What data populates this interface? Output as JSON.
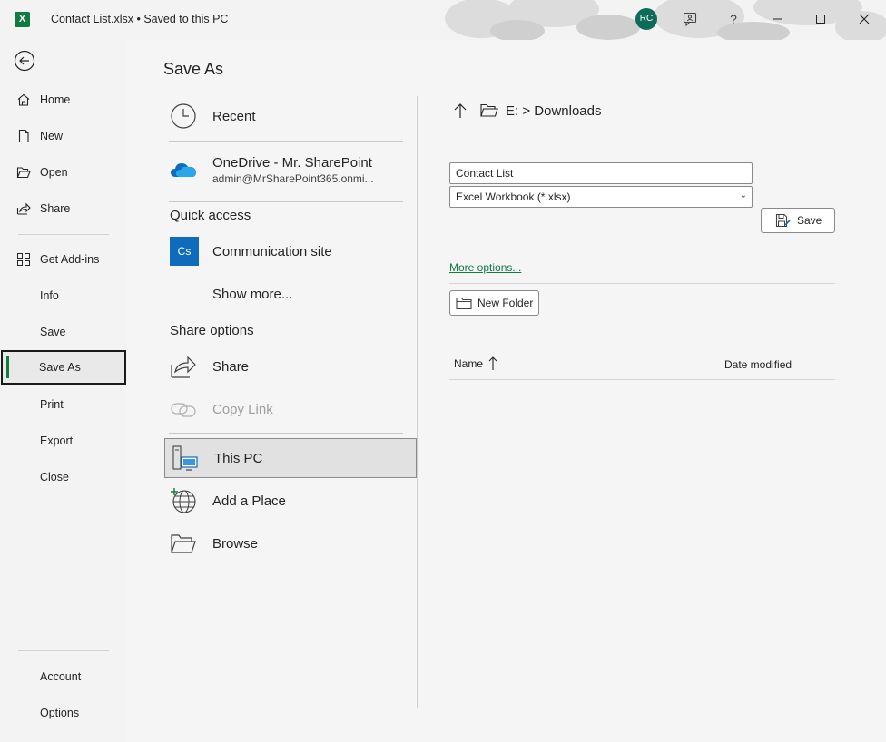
{
  "titlebar": {
    "app_icon": "excel-icon",
    "app_letter": "X",
    "document_title": "Contact List.xlsx  •  Saved to this PC",
    "avatar_initials": "RC",
    "help_label": "?",
    "buttons": [
      "feedback-icon",
      "help-icon",
      "minimize-icon",
      "maximize-icon",
      "close-icon"
    ]
  },
  "nav": {
    "items": [
      {
        "label": "Home",
        "icon": "home-icon"
      },
      {
        "label": "New",
        "icon": "new-document-icon"
      },
      {
        "label": "Open",
        "icon": "open-folder-icon"
      },
      {
        "label": "Share",
        "icon": "share-icon"
      },
      {
        "label": "Get Add-ins",
        "icon": "add-ins-icon"
      },
      {
        "label": "Info"
      },
      {
        "label": "Save"
      },
      {
        "label": "Save As",
        "active": true
      },
      {
        "label": "Print"
      },
      {
        "label": "Export"
      },
      {
        "label": "Close"
      },
      {
        "label": "Account"
      },
      {
        "label": "Options"
      }
    ]
  },
  "main": {
    "title": "Save As",
    "locations": {
      "recent": "Recent",
      "onedrive_title": "OneDrive - Mr. SharePoint",
      "onedrive_sub": "admin@MrSharePoint365.onmi...",
      "quick_access_head": "Quick access",
      "communication_badge": "Cs",
      "communication_site": "Communication site",
      "show_more": "Show more...",
      "share_options_head": "Share options",
      "share": "Share",
      "copy_link": "Copy Link",
      "this_pc": "This PC",
      "add_place": "Add a Place",
      "browse": "Browse"
    },
    "right": {
      "path": "E: > Downloads",
      "file_name": "Contact List",
      "file_type": "Excel Workbook (*.xlsx)",
      "save_label": "Save",
      "more_options": "More options...",
      "new_folder": "New Folder",
      "columns": [
        "Name",
        "Date modified"
      ]
    }
  },
  "colors": {
    "accent": "#107c41",
    "avatar": "#0e6b5a",
    "onedrive": "#0f6cbd",
    "communication_site": "#0f6cbd"
  }
}
